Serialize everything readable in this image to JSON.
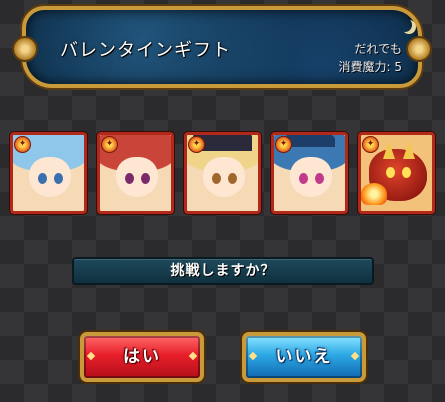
{
  "quest": {
    "title": "バレンタインギフト",
    "eligibility": "だれでも",
    "cost_label": "消費魔力: 5"
  },
  "party": [
    {
      "element": "fire",
      "hair_color": "#8fc7ea",
      "eye_color": "#3a6fb0"
    },
    {
      "element": "fire",
      "hair_color": "#c9453a",
      "eye_color": "#7a2a6a"
    },
    {
      "element": "fire",
      "hair_color": "#f0d48a",
      "eye_color": "#a0672a"
    },
    {
      "element": "fire",
      "hair_color": "#3c79b3",
      "eye_color": "#c23a8a"
    },
    {
      "element": "fire",
      "hair_color": "#d23a2a",
      "eye_color": "#2a2a2a"
    }
  ],
  "prompt": "挑戦しますか？",
  "buttons": {
    "yes_label": "はい",
    "no_label": "いいえ"
  },
  "colors": {
    "accent_gold": "#c89a3a",
    "yes_red": "#e81f2a",
    "no_blue": "#2ca8e6",
    "card_border": "#b0291b"
  }
}
